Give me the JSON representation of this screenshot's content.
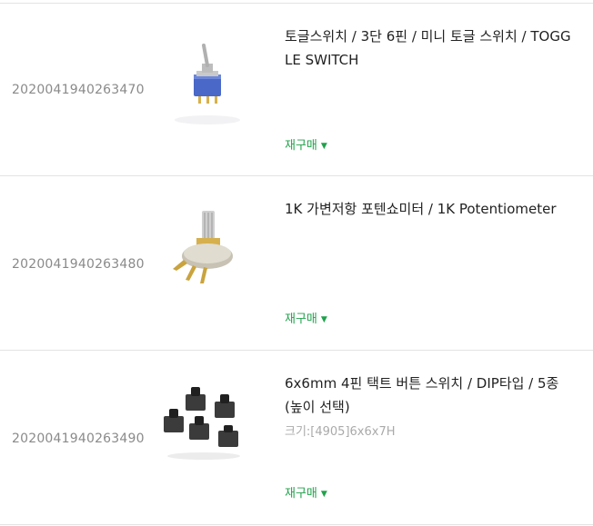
{
  "rebuy_label": "재구매",
  "items": [
    {
      "order_no": "2020041940263470",
      "title": "토글스위치 / 3단 6핀 / 미니 토글 스위치 / TOGGLE SWITCH",
      "option": "",
      "image_icon": "toggle-switch-photo"
    },
    {
      "order_no": "2020041940263480",
      "title": "1K 가변저항 포텐쇼미터 / 1K Potentiometer",
      "option": "",
      "image_icon": "potentiometer-photo"
    },
    {
      "order_no": "2020041940263490",
      "title": "6x6mm 4핀 택트 버튼 스위치 / DIP타입 / 5종(높이 선택)",
      "option": "크기:[4905]6x6x7H",
      "image_icon": "tact-switch-photo"
    }
  ],
  "colors": {
    "rebuy": "#1fa24a",
    "order_no": "#8a8a8a",
    "divider": "#e3e3e3"
  }
}
